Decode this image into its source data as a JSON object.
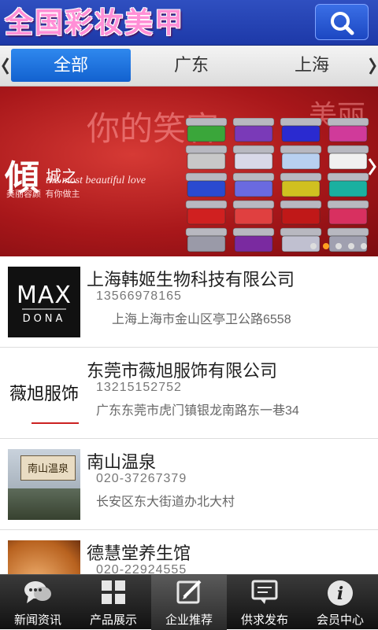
{
  "header": {
    "title": "全国彩妆美甲",
    "search_icon": "search-icon"
  },
  "tabs": [
    {
      "label": "全部",
      "active": true
    },
    {
      "label": "广东",
      "active": false
    },
    {
      "label": "上海",
      "active": false
    }
  ],
  "banner": {
    "line1": "你的笑容",
    "line1b": "美丽",
    "brand": "傾",
    "brand2": "城之",
    "tagline": "the most beautiful love",
    "sub": "美丽容颜  有你做主",
    "dots_total": 5,
    "dots_active": 2
  },
  "list": [
    {
      "name": "上海韩姬生物科技有限公司",
      "phone": "13566978165",
      "address": "上海上海市金山区亭卫公路6558",
      "thumb": "MAX DONA"
    },
    {
      "name": "东莞市薇旭服饰有限公司",
      "phone": "13215152752",
      "address": "广东东莞市虎门镇银龙南路东一巷34",
      "thumb": "薇旭服饰"
    },
    {
      "name": "南山温泉",
      "phone": "020-37267379",
      "address": "长安区东大街道办北大村",
      "thumb": "南山温泉"
    },
    {
      "name": "德慧堂养生馆",
      "phone": "020-22924555",
      "address": "",
      "thumb": ""
    }
  ],
  "bottom_nav": [
    {
      "label": "新闻资讯",
      "icon": "chat-bubble-icon",
      "active": false
    },
    {
      "label": "产品展示",
      "icon": "grid-icon",
      "active": false
    },
    {
      "label": "企业推荐",
      "icon": "edit-icon",
      "active": true
    },
    {
      "label": "供求发布",
      "icon": "message-icon",
      "active": false
    },
    {
      "label": "会员中心",
      "icon": "info-icon",
      "active": false
    }
  ],
  "colors": {
    "header": "#2a47b8",
    "tab_active": "#1f74e0",
    "banner": "#b51d1f",
    "nav_bar": "#222222"
  }
}
